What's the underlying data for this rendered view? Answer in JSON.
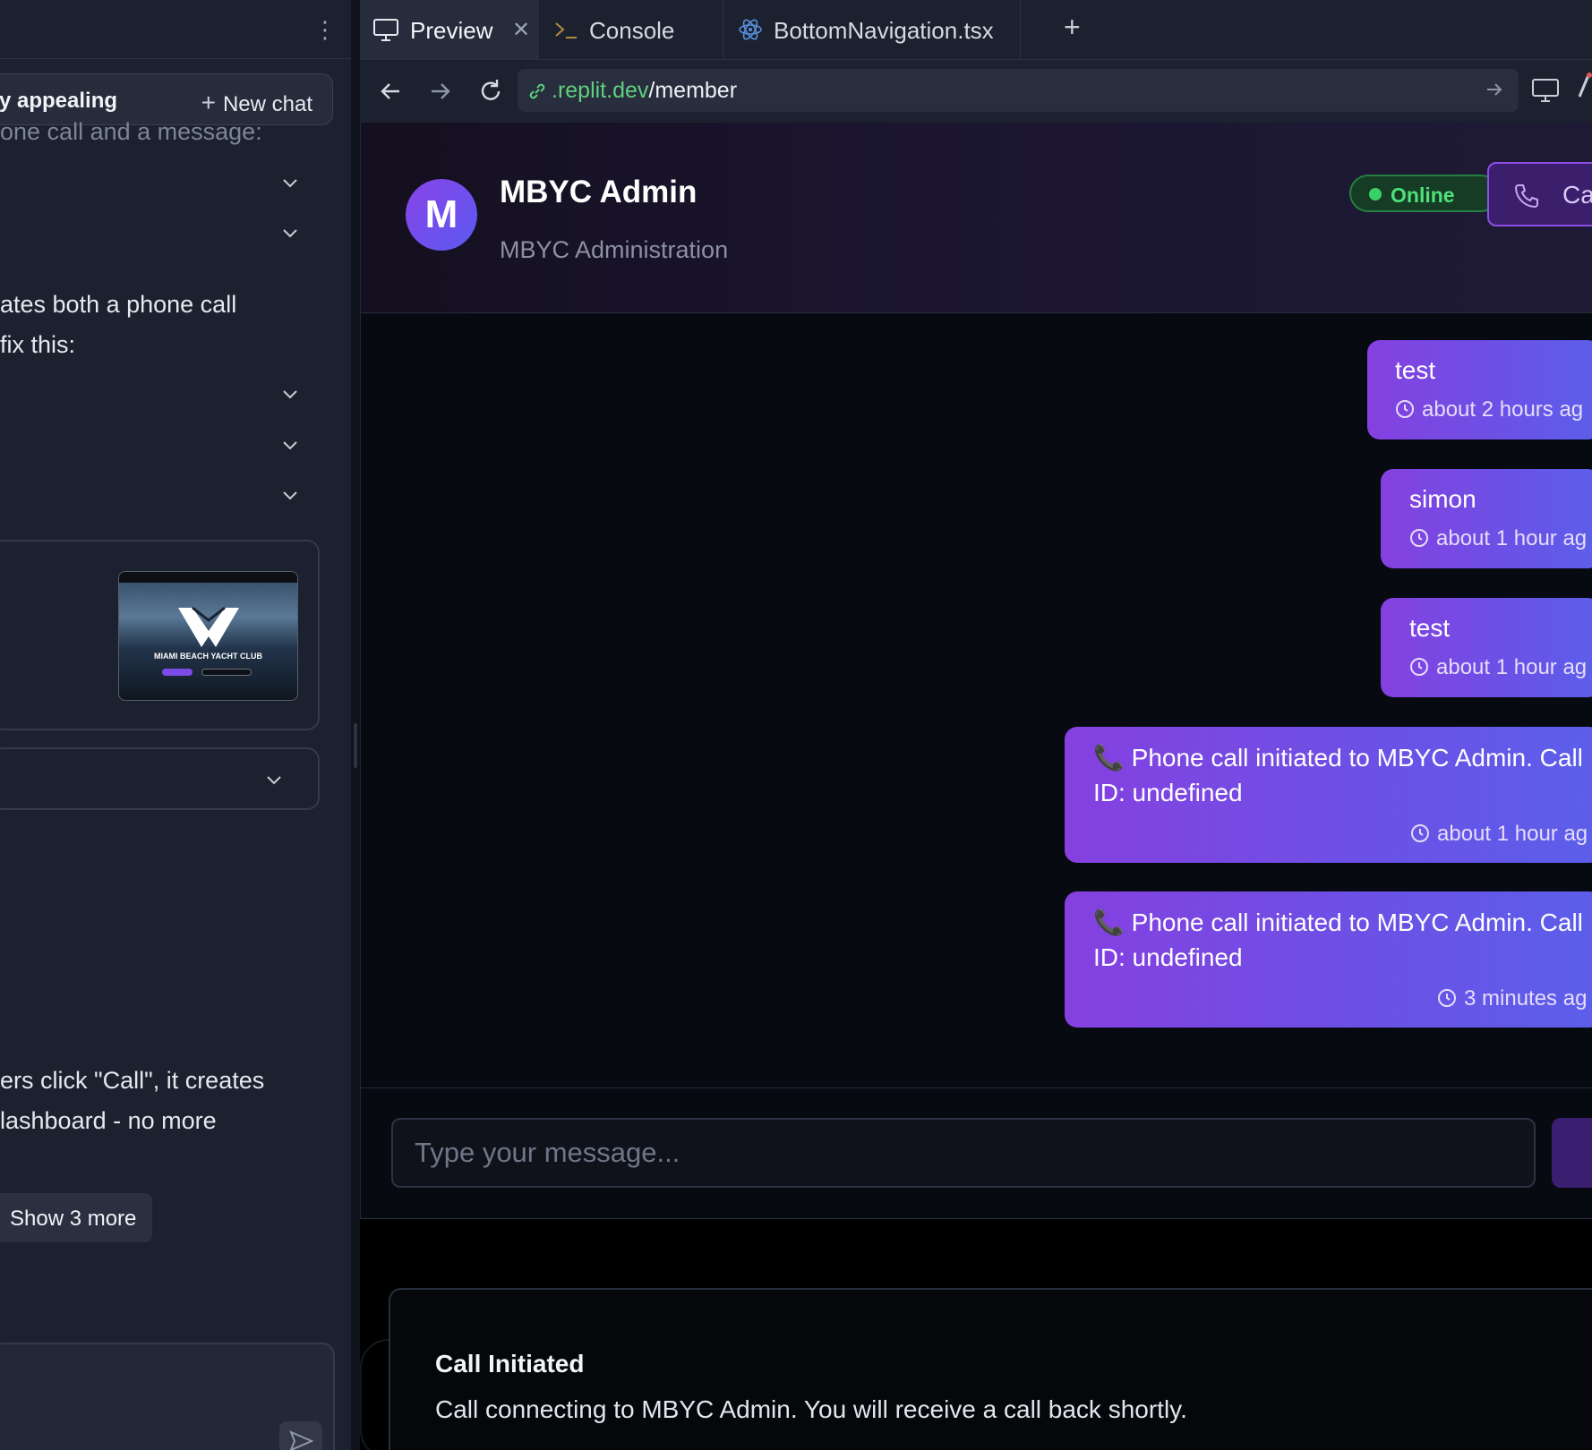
{
  "left_panel": {
    "chat_title": "y appealing",
    "new_chat_label": "New chat",
    "faded_line": "one call and a message:",
    "text_block_1": [
      "ates both a phone call",
      "fix this:"
    ],
    "thumbnail_caption": "MIAMI BEACH YACHT CLUB",
    "text_block_2": [
      "ers click \"Call\", it creates",
      "lashboard - no more"
    ],
    "show_more_label": "Show 3 more"
  },
  "tabs": [
    {
      "label": "Preview",
      "icon": "monitor-icon",
      "active": true
    },
    {
      "label": "Console",
      "icon": "terminal-icon"
    },
    {
      "label": "BottomNavigation.tsx",
      "icon": "react-icon"
    }
  ],
  "url": {
    "host": ".replit.dev",
    "path": "/member"
  },
  "chat_header": {
    "avatar_letter": "M",
    "name": "MBYC Admin",
    "subtitle": "MBYC Administration",
    "status": "Online",
    "call_label": "Cal"
  },
  "messages": [
    {
      "text": "test",
      "time": "about 2 hours ag"
    },
    {
      "text": "simon",
      "time": "about 1 hour ag"
    },
    {
      "text": "test",
      "time": "about 1 hour ag"
    },
    {
      "line1": "📞 Phone call initiated to MBYC Admin. Call",
      "line2": "ID: undefined",
      "time": "about 1 hour ag"
    },
    {
      "line1": "📞 Phone call initiated to MBYC Admin. Call",
      "line2": "ID: undefined",
      "time": "3 minutes ag"
    }
  ],
  "composer": {
    "placeholder": "Type your message..."
  },
  "toast": {
    "title": "Call Initiated",
    "description": "Call connecting to MBYC Admin. You will receive a call back shortly."
  },
  "colors": {
    "accent_purple": "#8540e0",
    "accent_blue": "#5b5fea",
    "online_green": "#4ee07a",
    "url_host_green": "#5fd07c"
  }
}
